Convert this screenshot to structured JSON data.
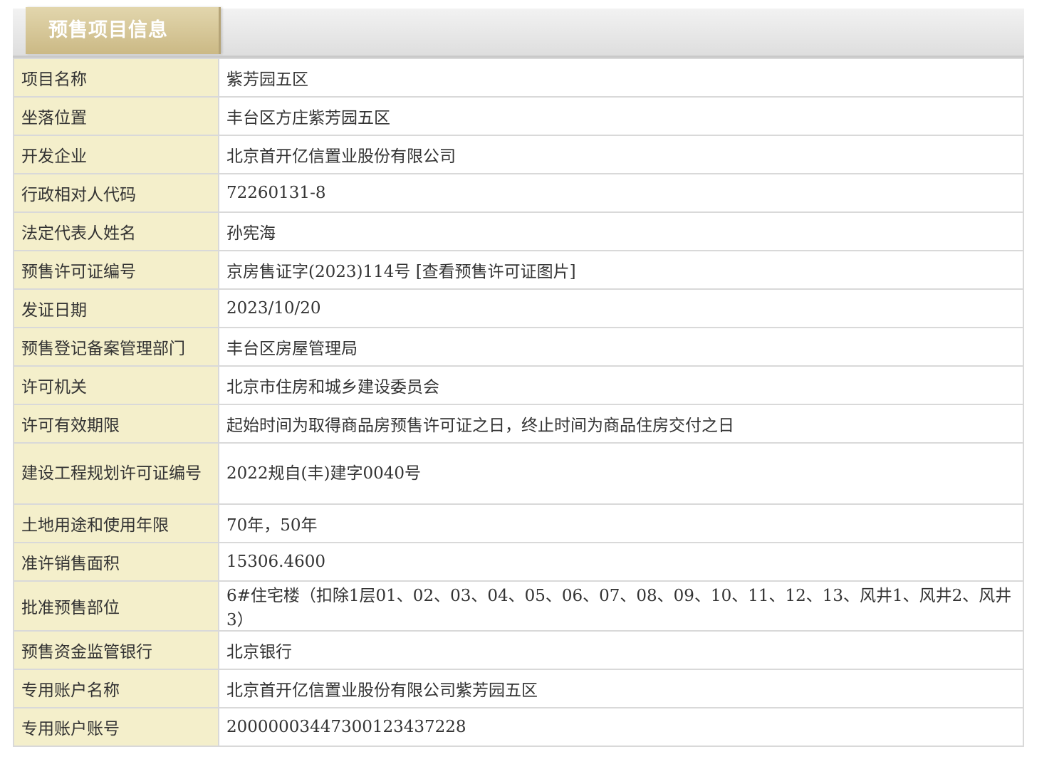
{
  "section": {
    "tab_title": "预售项目信息"
  },
  "rows": [
    {
      "label": "项目名称",
      "value": "紫芳园五区"
    },
    {
      "label": "坐落位置",
      "value": "丰台区方庄紫芳园五区"
    },
    {
      "label": "开发企业",
      "value": "北京首开亿信置业股份有限公司"
    },
    {
      "label": "行政相对人代码",
      "value": "72260131-8"
    },
    {
      "label": "法定代表人姓名",
      "value": "孙宪海"
    },
    {
      "label": "预售许可证编号",
      "value": "京房售证字(2023)114号 ",
      "link": "[查看预售许可证图片]"
    },
    {
      "label": "发证日期",
      "value": "2023/10/20"
    },
    {
      "label": "预售登记备案管理部门",
      "value": "丰台区房屋管理局"
    },
    {
      "label": "许可机关",
      "value": "北京市住房和城乡建设委员会"
    },
    {
      "label": "许可有效期限",
      "value": "起始时间为取得商品房预售许可证之日，终止时间为商品住房交付之日"
    },
    {
      "label": "建设工程规划许可证编号",
      "value": "2022规自(丰)建字0040号"
    },
    {
      "label": "土地用途和使用年限",
      "value": "70年，50年"
    },
    {
      "label": "准许销售面积",
      "value": "15306.4600"
    },
    {
      "label": "批准预售部位",
      "value": "6#住宅楼（扣除1层01、02、03、04、05、06、07、08、09、10、11、12、13、风井1、风井2、风井3）"
    },
    {
      "label": "预售资金监管银行",
      "value": "北京银行"
    },
    {
      "label": "专用账户名称",
      "value": "北京首开亿信置业股份有限公司紫芳园五区"
    },
    {
      "label": "专用账户账号",
      "value": "20000003447300123437228"
    }
  ],
  "colors": {
    "label_background": "#f4efcb",
    "tab_background": "#cbb985",
    "border": "#d9d9d9"
  }
}
